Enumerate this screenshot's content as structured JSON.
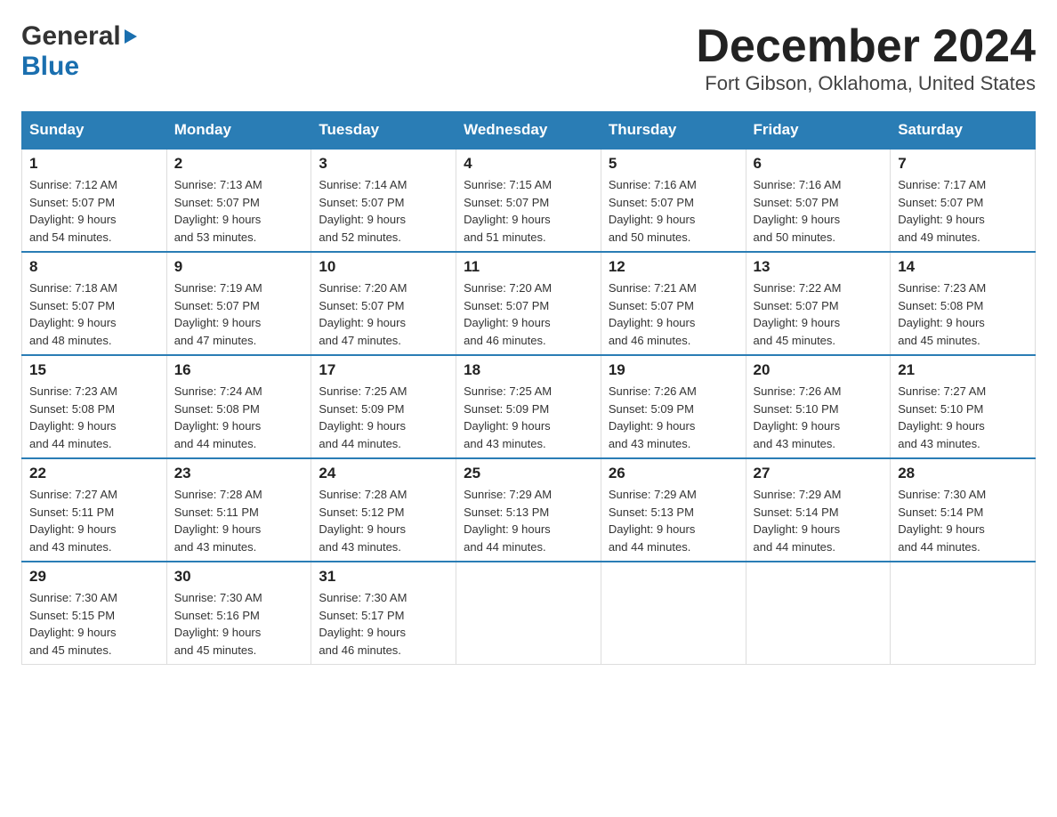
{
  "header": {
    "logo_general": "General",
    "logo_blue": "Blue",
    "title": "December 2024",
    "subtitle": "Fort Gibson, Oklahoma, United States"
  },
  "calendar": {
    "days_of_week": [
      "Sunday",
      "Monday",
      "Tuesday",
      "Wednesday",
      "Thursday",
      "Friday",
      "Saturday"
    ],
    "weeks": [
      [
        {
          "day": "1",
          "sunrise": "7:12 AM",
          "sunset": "5:07 PM",
          "daylight": "9 hours and 54 minutes."
        },
        {
          "day": "2",
          "sunrise": "7:13 AM",
          "sunset": "5:07 PM",
          "daylight": "9 hours and 53 minutes."
        },
        {
          "day": "3",
          "sunrise": "7:14 AM",
          "sunset": "5:07 PM",
          "daylight": "9 hours and 52 minutes."
        },
        {
          "day": "4",
          "sunrise": "7:15 AM",
          "sunset": "5:07 PM",
          "daylight": "9 hours and 51 minutes."
        },
        {
          "day": "5",
          "sunrise": "7:16 AM",
          "sunset": "5:07 PM",
          "daylight": "9 hours and 50 minutes."
        },
        {
          "day": "6",
          "sunrise": "7:16 AM",
          "sunset": "5:07 PM",
          "daylight": "9 hours and 50 minutes."
        },
        {
          "day": "7",
          "sunrise": "7:17 AM",
          "sunset": "5:07 PM",
          "daylight": "9 hours and 49 minutes."
        }
      ],
      [
        {
          "day": "8",
          "sunrise": "7:18 AM",
          "sunset": "5:07 PM",
          "daylight": "9 hours and 48 minutes."
        },
        {
          "day": "9",
          "sunrise": "7:19 AM",
          "sunset": "5:07 PM",
          "daylight": "9 hours and 47 minutes."
        },
        {
          "day": "10",
          "sunrise": "7:20 AM",
          "sunset": "5:07 PM",
          "daylight": "9 hours and 47 minutes."
        },
        {
          "day": "11",
          "sunrise": "7:20 AM",
          "sunset": "5:07 PM",
          "daylight": "9 hours and 46 minutes."
        },
        {
          "day": "12",
          "sunrise": "7:21 AM",
          "sunset": "5:07 PM",
          "daylight": "9 hours and 46 minutes."
        },
        {
          "day": "13",
          "sunrise": "7:22 AM",
          "sunset": "5:07 PM",
          "daylight": "9 hours and 45 minutes."
        },
        {
          "day": "14",
          "sunrise": "7:23 AM",
          "sunset": "5:08 PM",
          "daylight": "9 hours and 45 minutes."
        }
      ],
      [
        {
          "day": "15",
          "sunrise": "7:23 AM",
          "sunset": "5:08 PM",
          "daylight": "9 hours and 44 minutes."
        },
        {
          "day": "16",
          "sunrise": "7:24 AM",
          "sunset": "5:08 PM",
          "daylight": "9 hours and 44 minutes."
        },
        {
          "day": "17",
          "sunrise": "7:25 AM",
          "sunset": "5:09 PM",
          "daylight": "9 hours and 44 minutes."
        },
        {
          "day": "18",
          "sunrise": "7:25 AM",
          "sunset": "5:09 PM",
          "daylight": "9 hours and 43 minutes."
        },
        {
          "day": "19",
          "sunrise": "7:26 AM",
          "sunset": "5:09 PM",
          "daylight": "9 hours and 43 minutes."
        },
        {
          "day": "20",
          "sunrise": "7:26 AM",
          "sunset": "5:10 PM",
          "daylight": "9 hours and 43 minutes."
        },
        {
          "day": "21",
          "sunrise": "7:27 AM",
          "sunset": "5:10 PM",
          "daylight": "9 hours and 43 minutes."
        }
      ],
      [
        {
          "day": "22",
          "sunrise": "7:27 AM",
          "sunset": "5:11 PM",
          "daylight": "9 hours and 43 minutes."
        },
        {
          "day": "23",
          "sunrise": "7:28 AM",
          "sunset": "5:11 PM",
          "daylight": "9 hours and 43 minutes."
        },
        {
          "day": "24",
          "sunrise": "7:28 AM",
          "sunset": "5:12 PM",
          "daylight": "9 hours and 43 minutes."
        },
        {
          "day": "25",
          "sunrise": "7:29 AM",
          "sunset": "5:13 PM",
          "daylight": "9 hours and 44 minutes."
        },
        {
          "day": "26",
          "sunrise": "7:29 AM",
          "sunset": "5:13 PM",
          "daylight": "9 hours and 44 minutes."
        },
        {
          "day": "27",
          "sunrise": "7:29 AM",
          "sunset": "5:14 PM",
          "daylight": "9 hours and 44 minutes."
        },
        {
          "day": "28",
          "sunrise": "7:30 AM",
          "sunset": "5:14 PM",
          "daylight": "9 hours and 44 minutes."
        }
      ],
      [
        {
          "day": "29",
          "sunrise": "7:30 AM",
          "sunset": "5:15 PM",
          "daylight": "9 hours and 45 minutes."
        },
        {
          "day": "30",
          "sunrise": "7:30 AM",
          "sunset": "5:16 PM",
          "daylight": "9 hours and 45 minutes."
        },
        {
          "day": "31",
          "sunrise": "7:30 AM",
          "sunset": "5:17 PM",
          "daylight": "9 hours and 46 minutes."
        },
        null,
        null,
        null,
        null
      ]
    ]
  }
}
